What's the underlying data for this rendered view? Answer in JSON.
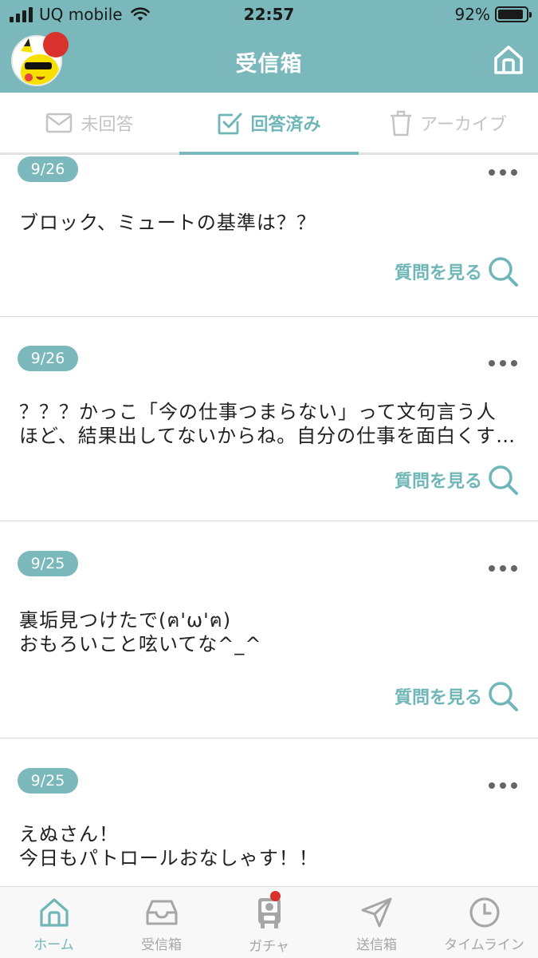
{
  "status_bar": {
    "carrier": "UQ mobile",
    "time": "22:57",
    "battery": "92%",
    "battery_level": 0.92
  },
  "header": {
    "title": "受信箱",
    "avatar_icon": "pikachu-avatar",
    "home_icon": "home-icon"
  },
  "tabs": [
    {
      "label": "未回答",
      "icon": "mail-icon",
      "active": false
    },
    {
      "label": "回答済み",
      "icon": "checkbox-icon",
      "active": true
    },
    {
      "label": "アーカイブ",
      "icon": "trash-icon",
      "active": false
    }
  ],
  "questions": [
    {
      "date": "9/26",
      "text": "ブロック、ミュートの基準は？？",
      "link": "質問を見る"
    },
    {
      "date": "9/26",
      "text": "？？？かっこ「今の仕事つまらない」って文句言う人ほど、結果出してないからね。自分の仕事を面白くするのも自分次第なのに。",
      "link": "質問を見る"
    },
    {
      "date": "9/25",
      "text": "裏垢見つけたで(ฅ'ω'ฅ)\nおもろいこと呟いてな^_^",
      "link": "質問を見る"
    },
    {
      "date": "9/25",
      "text": "えぬさん！\n今日もパトロールおなしゃす！！",
      "link": "質問を見る"
    }
  ],
  "bottom_nav": [
    {
      "label": "ホーム",
      "icon": "home-icon",
      "active": true
    },
    {
      "label": "受信箱",
      "icon": "inbox-icon",
      "active": false
    },
    {
      "label": "ガチャ",
      "icon": "gacha-icon",
      "active": false,
      "badge": true
    },
    {
      "label": "送信箱",
      "icon": "send-icon",
      "active": false
    },
    {
      "label": "タイムライン",
      "icon": "clock-icon",
      "active": false
    }
  ],
  "colors": {
    "accent": "#7ab8bb",
    "accent_text": "#6fb6b9",
    "badge_red": "#d9322d",
    "inactive": "#a6a6a6"
  }
}
